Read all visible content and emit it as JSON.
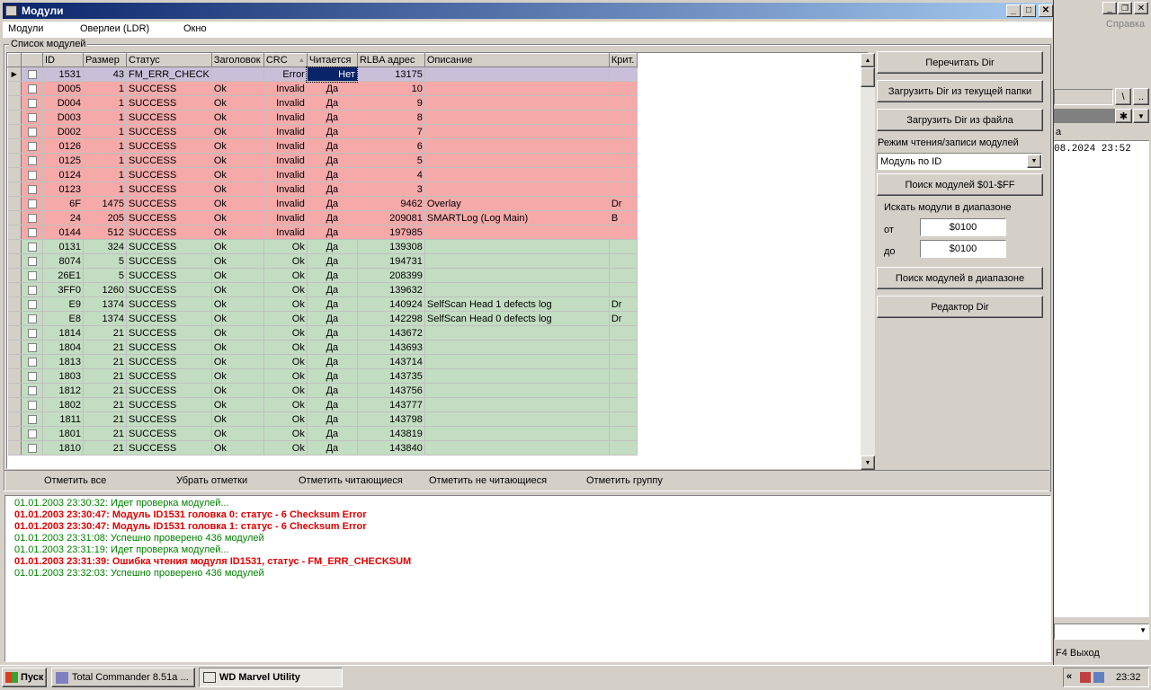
{
  "window": {
    "title": "Модули"
  },
  "menu": [
    "Модули",
    "Оверлеи (LDR)",
    "Окно"
  ],
  "group_label": "Список модулей",
  "columns": [
    "ID",
    "Размер",
    "Статус",
    "Заголовок",
    "CRC",
    "Читается",
    "RLBA адрес",
    "Описание",
    "Крит."
  ],
  "rows": [
    {
      "id": "1531",
      "size": "43",
      "status": "FM_ERR_CHECK",
      "header": "",
      "crc": "Error",
      "read": "Нет",
      "rlba": "13175",
      "desc": "",
      "crit": "",
      "color": "#c9bfd9"
    },
    {
      "id": "D005",
      "size": "1",
      "status": "SUCCESS",
      "header": "Ok",
      "crc": "Invalid",
      "read": "Да",
      "rlba": "10",
      "desc": "",
      "crit": "",
      "color": "#f5a9a9"
    },
    {
      "id": "D004",
      "size": "1",
      "status": "SUCCESS",
      "header": "Ok",
      "crc": "Invalid",
      "read": "Да",
      "rlba": "9",
      "desc": "",
      "crit": "",
      "color": "#f5a9a9"
    },
    {
      "id": "D003",
      "size": "1",
      "status": "SUCCESS",
      "header": "Ok",
      "crc": "Invalid",
      "read": "Да",
      "rlba": "8",
      "desc": "",
      "crit": "",
      "color": "#f5a9a9"
    },
    {
      "id": "D002",
      "size": "1",
      "status": "SUCCESS",
      "header": "Ok",
      "crc": "Invalid",
      "read": "Да",
      "rlba": "7",
      "desc": "",
      "crit": "",
      "color": "#f5a9a9"
    },
    {
      "id": "0126",
      "size": "1",
      "status": "SUCCESS",
      "header": "Ok",
      "crc": "Invalid",
      "read": "Да",
      "rlba": "6",
      "desc": "",
      "crit": "",
      "color": "#f5a9a9"
    },
    {
      "id": "0125",
      "size": "1",
      "status": "SUCCESS",
      "header": "Ok",
      "crc": "Invalid",
      "read": "Да",
      "rlba": "5",
      "desc": "",
      "crit": "",
      "color": "#f5a9a9"
    },
    {
      "id": "0124",
      "size": "1",
      "status": "SUCCESS",
      "header": "Ok",
      "crc": "Invalid",
      "read": "Да",
      "rlba": "4",
      "desc": "",
      "crit": "",
      "color": "#f5a9a9"
    },
    {
      "id": "0123",
      "size": "1",
      "status": "SUCCESS",
      "header": "Ok",
      "crc": "Invalid",
      "read": "Да",
      "rlba": "3",
      "desc": "",
      "crit": "",
      "color": "#f5a9a9"
    },
    {
      "id": "6F",
      "size": "1475",
      "status": "SUCCESS",
      "header": "Ok",
      "crc": "Invalid",
      "read": "Да",
      "rlba": "9462",
      "desc": "Overlay",
      "crit": "Dr",
      "color": "#f5a9a9"
    },
    {
      "id": "24",
      "size": "205",
      "status": "SUCCESS",
      "header": "Ok",
      "crc": "Invalid",
      "read": "Да",
      "rlba": "209081",
      "desc": "SMARTLog (Log Main)",
      "crit": "B",
      "color": "#f5a9a9"
    },
    {
      "id": "0144",
      "size": "512",
      "status": "SUCCESS",
      "header": "Ok",
      "crc": "Invalid",
      "read": "Да",
      "rlba": "197985",
      "desc": "",
      "crit": "",
      "color": "#f5a9a9"
    },
    {
      "id": "0131",
      "size": "324",
      "status": "SUCCESS",
      "header": "Ok",
      "crc": "Ok",
      "read": "Да",
      "rlba": "139308",
      "desc": "",
      "crit": "",
      "color": "#c3ddc3"
    },
    {
      "id": "8074",
      "size": "5",
      "status": "SUCCESS",
      "header": "Ok",
      "crc": "Ok",
      "read": "Да",
      "rlba": "194731",
      "desc": "",
      "crit": "",
      "color": "#c3ddc3"
    },
    {
      "id": "26E1",
      "size": "5",
      "status": "SUCCESS",
      "header": "Ok",
      "crc": "Ok",
      "read": "Да",
      "rlba": "208399",
      "desc": "",
      "crit": "",
      "color": "#c3ddc3"
    },
    {
      "id": "3FF0",
      "size": "1260",
      "status": "SUCCESS",
      "header": "Ok",
      "crc": "Ok",
      "read": "Да",
      "rlba": "139632",
      "desc": "",
      "crit": "",
      "color": "#c3ddc3"
    },
    {
      "id": "E9",
      "size": "1374",
      "status": "SUCCESS",
      "header": "Ok",
      "crc": "Ok",
      "read": "Да",
      "rlba": "140924",
      "desc": "SelfScan Head 1 defects log",
      "crit": "Dr",
      "color": "#c3ddc3"
    },
    {
      "id": "E8",
      "size": "1374",
      "status": "SUCCESS",
      "header": "Ok",
      "crc": "Ok",
      "read": "Да",
      "rlba": "142298",
      "desc": "SelfScan Head 0 defects log",
      "crit": "Dr",
      "color": "#c3ddc3"
    },
    {
      "id": "1814",
      "size": "21",
      "status": "SUCCESS",
      "header": "Ok",
      "crc": "Ok",
      "read": "Да",
      "rlba": "143672",
      "desc": "",
      "crit": "",
      "color": "#c3ddc3"
    },
    {
      "id": "1804",
      "size": "21",
      "status": "SUCCESS",
      "header": "Ok",
      "crc": "Ok",
      "read": "Да",
      "rlba": "143693",
      "desc": "",
      "crit": "",
      "color": "#c3ddc3"
    },
    {
      "id": "1813",
      "size": "21",
      "status": "SUCCESS",
      "header": "Ok",
      "crc": "Ok",
      "read": "Да",
      "rlba": "143714",
      "desc": "",
      "crit": "",
      "color": "#c3ddc3"
    },
    {
      "id": "1803",
      "size": "21",
      "status": "SUCCESS",
      "header": "Ok",
      "crc": "Ok",
      "read": "Да",
      "rlba": "143735",
      "desc": "",
      "crit": "",
      "color": "#c3ddc3"
    },
    {
      "id": "1812",
      "size": "21",
      "status": "SUCCESS",
      "header": "Ok",
      "crc": "Ok",
      "read": "Да",
      "rlba": "143756",
      "desc": "",
      "crit": "",
      "color": "#c3ddc3"
    },
    {
      "id": "1802",
      "size": "21",
      "status": "SUCCESS",
      "header": "Ok",
      "crc": "Ok",
      "read": "Да",
      "rlba": "143777",
      "desc": "",
      "crit": "",
      "color": "#c3ddc3"
    },
    {
      "id": "1811",
      "size": "21",
      "status": "SUCCESS",
      "header": "Ok",
      "crc": "Ok",
      "read": "Да",
      "rlba": "143798",
      "desc": "",
      "crit": "",
      "color": "#c3ddc3"
    },
    {
      "id": "1801",
      "size": "21",
      "status": "SUCCESS",
      "header": "Ok",
      "crc": "Ok",
      "read": "Да",
      "rlba": "143819",
      "desc": "",
      "crit": "",
      "color": "#c3ddc3"
    },
    {
      "id": "1810",
      "size": "21",
      "status": "SUCCESS",
      "header": "Ok",
      "crc": "Ok",
      "read": "Да",
      "rlba": "143840",
      "desc": "",
      "crit": "",
      "color": "#c3ddc3"
    }
  ],
  "right_panel": {
    "reread_dir": "Перечитать Dir",
    "load_dir_current": "Загрузить Dir из текущей папки",
    "load_dir_file": "Загрузить Dir из файла",
    "mode_label": "Режим чтения/записи модулей",
    "mode_value": "Модуль по ID",
    "search_01_ff": "Поиск модулей $01-$FF",
    "range_label": "Искать модули в диапазоне",
    "from_label": "от",
    "from_value": "$0100",
    "to_label": "до",
    "to_value": "$0100",
    "search_range": "Поиск модулей в диапазоне",
    "dir_editor": "Редактор Dir"
  },
  "bottom_buttons": [
    "Отметить все",
    "Убрать отметки",
    "Отметить читающиеся",
    "Отметить не читающиеся",
    "Отметить группу"
  ],
  "log": [
    {
      "text": "01.01.2003 23:30:32: Идет проверка модулей...",
      "error": false
    },
    {
      "text": "01.01.2003 23:30:47: Модуль ID1531 головка 0: статус - 6 Checksum Error",
      "error": true
    },
    {
      "text": "01.01.2003 23:30:47: Модуль ID1531 головка 1: статус - 6 Checksum Error",
      "error": true
    },
    {
      "text": "01.01.2003 23:31:08: Успешно проверено 436 модулей",
      "error": false
    },
    {
      "text": "01.01.2003 23:31:19: Идет проверка модулей...",
      "error": false
    },
    {
      "text": "01.01.2003 23:31:39: Ошибка чтения модуля ID1531, статус - FM_ERR_CHECKSUM",
      "error": true
    },
    {
      "text": "01.01.2003 23:32:03: Успешно проверено 436 модулей",
      "error": false
    }
  ],
  "background_window": {
    "help_menu": "Справка",
    "date_fragment": "08.2024 23:52",
    "col_fragment": "a",
    "f4_exit": "F4 Выход",
    "path_btn1": "\\",
    "path_btn2": ".."
  },
  "taskbar": {
    "start": "Пуск",
    "tasks": [
      "Total Commander 8.51a ...",
      "WD Marvel Utility"
    ],
    "clock": "23:32"
  }
}
